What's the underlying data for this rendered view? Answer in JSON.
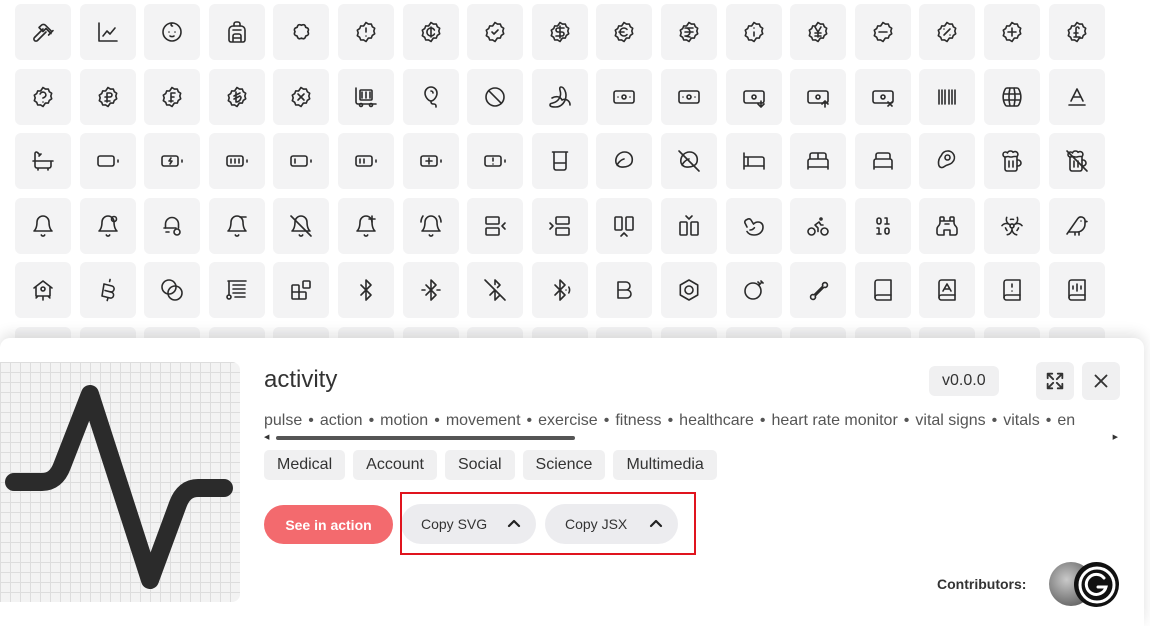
{
  "icon_grid": {
    "rows": [
      [
        "hammer-icon",
        "chart-line-icon",
        "baby-face-icon",
        "backpack-icon",
        "badge-icon",
        "badge-alert-icon",
        "badge-cent-icon",
        "badge-check-icon",
        "badge-dollar-icon",
        "badge-euro-icon",
        "badge-indian-rupee-icon",
        "badge-info-icon",
        "badge-japanese-yen-icon",
        "badge-minus-icon",
        "badge-percent-icon",
        "badge-plus-icon",
        "badge-pound-icon"
      ],
      [
        "badge-help-icon",
        "badge-ruble-icon",
        "badge-swiss-franc-icon",
        "badge-turkish-lira-icon",
        "badge-x-icon",
        "baggage-cart-icon",
        "balloon-icon",
        "ban-icon",
        "banana-icon",
        "banknote-icon",
        "banknote-icon",
        "banknote-arrow-down-icon",
        "banknote-arrow-up-icon",
        "banknote-x-icon",
        "barcode-icon",
        "barrel-icon",
        "baseline-icon"
      ],
      [
        "bath-icon",
        "battery-icon",
        "battery-charging-icon",
        "battery-full-icon",
        "battery-low-icon",
        "battery-medium-icon",
        "battery-plus-icon",
        "battery-warning-icon",
        "beaker-icon",
        "bean-icon",
        "bean-off-icon",
        "bed-icon",
        "bed-double-icon",
        "bed-single-icon",
        "beef-icon",
        "beer-icon",
        "beer-off-icon"
      ],
      [
        "bell-icon",
        "bell-dot-icon",
        "bell-electric-icon",
        "bell-minus-icon",
        "bell-off-icon",
        "bell-plus-icon",
        "bell-ring-icon",
        "between-horizontal-end-icon",
        "between-horizontal-start-icon",
        "between-vertical-end-icon",
        "between-vertical-start-icon",
        "biceps-flexed-icon",
        "bike-icon",
        "binary-icon",
        "binoculars-icon",
        "biohazard-icon",
        "bird-icon"
      ],
      [
        "birdhouse-icon",
        "bitcoin-icon",
        "blend-icon",
        "blinds-icon",
        "blocks-icon",
        "bluetooth-icon",
        "bluetooth-connected-icon",
        "bluetooth-off-icon",
        "bluetooth-searching-icon",
        "bold-icon",
        "bolt-icon",
        "bomb-icon",
        "bone-icon",
        "book-icon",
        "book-a-icon",
        "book-alert-icon",
        "book-audio-icon"
      ]
    ]
  },
  "detail": {
    "icon_name": "activity",
    "version": "v0.0.0",
    "tags": [
      "pulse",
      "action",
      "motion",
      "movement",
      "exercise",
      "fitness",
      "healthcare",
      "heart rate monitor",
      "vital signs",
      "vitals",
      "en"
    ],
    "tag_separator": "•",
    "categories": [
      "Medical",
      "Account",
      "Social",
      "Science",
      "Multimedia"
    ],
    "see_in_action_label": "See in action",
    "copy_svg_label": "Copy SVG",
    "copy_jsx_label": "Copy JSX",
    "contributors_label": "Contributors:"
  },
  "colors": {
    "accent": "#f36a6e",
    "highlight_border": "#e0141e",
    "tile_bg": "#f3f3f4"
  }
}
